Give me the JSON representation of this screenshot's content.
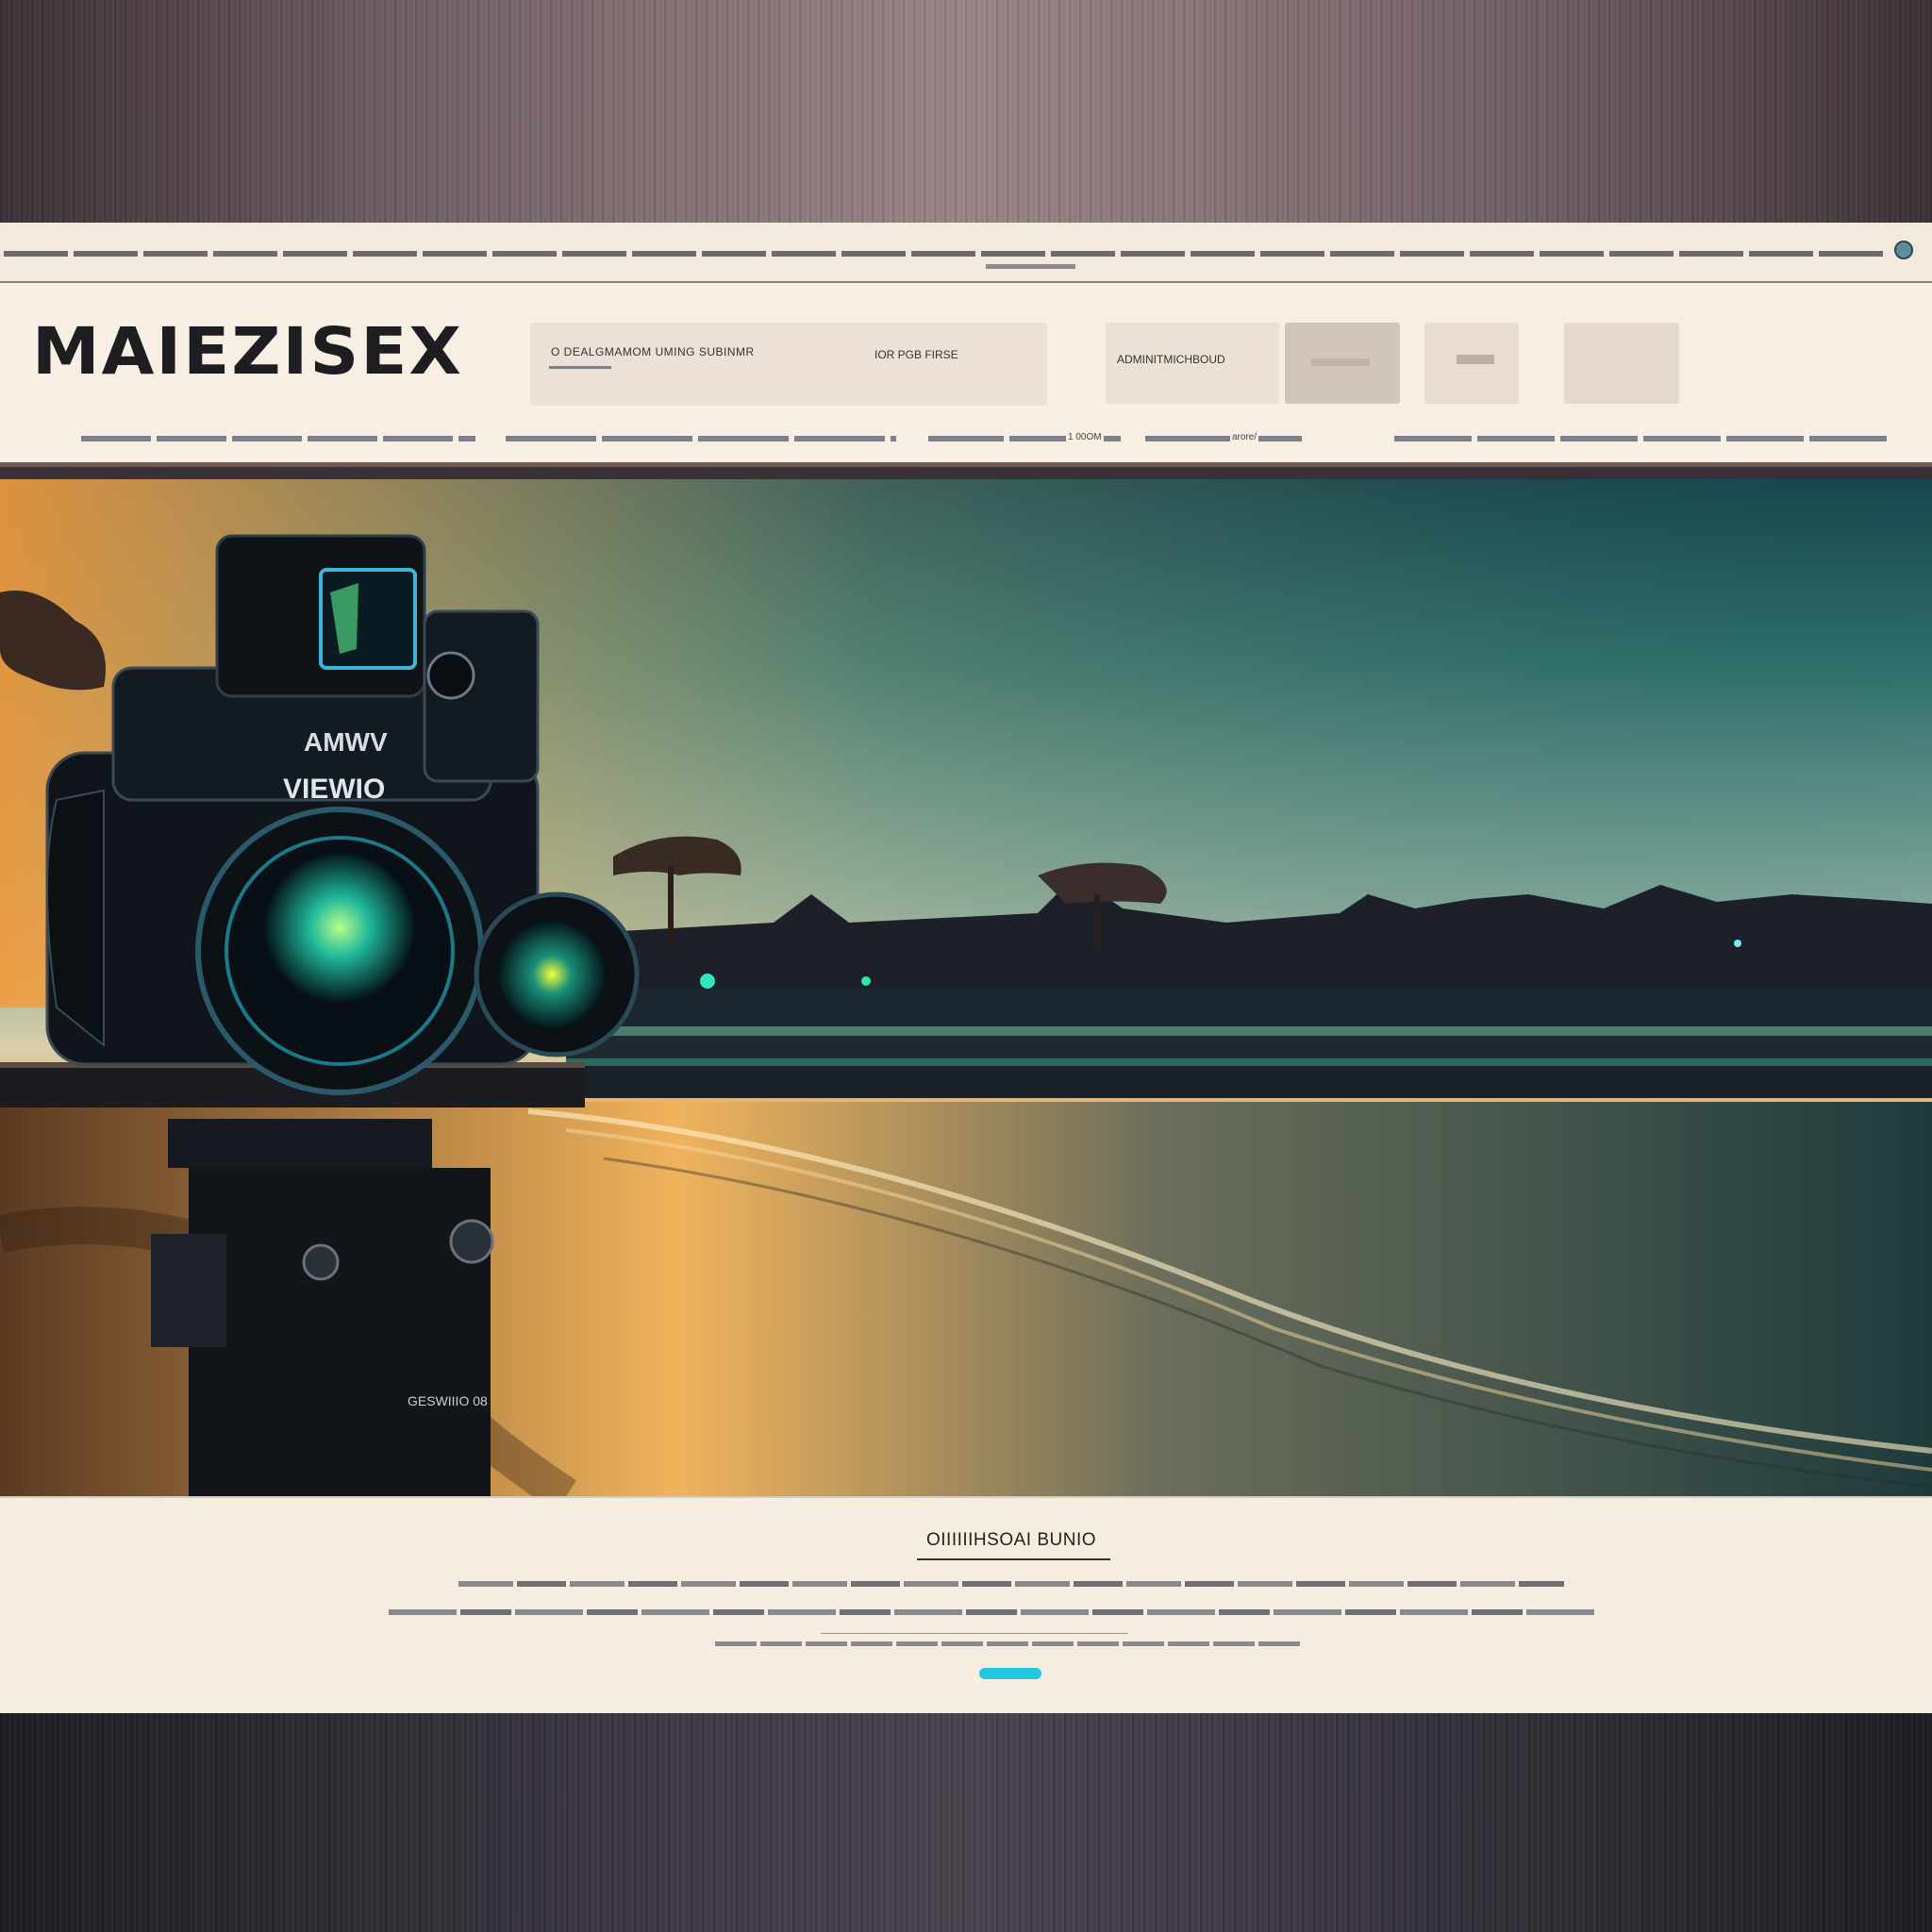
{
  "brand": {
    "logo_text": "MAIEZISEX",
    "logo_mark": "X"
  },
  "header": {
    "search_text": "O DEALGMAMOM UMING SUBINMR",
    "search_secondary": "IOR PGB FIRSE",
    "button_1_label": "ADMINITMICHBOUD",
    "nav_label_1": "1 00OM",
    "nav_label_2": "arore/"
  },
  "hero": {
    "camera_top_label": "AMWV",
    "camera_brand": "VIEWIO",
    "tripod_label": "GESWIIIO 08"
  },
  "content": {
    "title": "OIIIIIIHSOAI BUNIO"
  },
  "colors": {
    "accent": "#22c6df",
    "header_bg": "#f7efe4",
    "divider": "#6e5f55"
  }
}
